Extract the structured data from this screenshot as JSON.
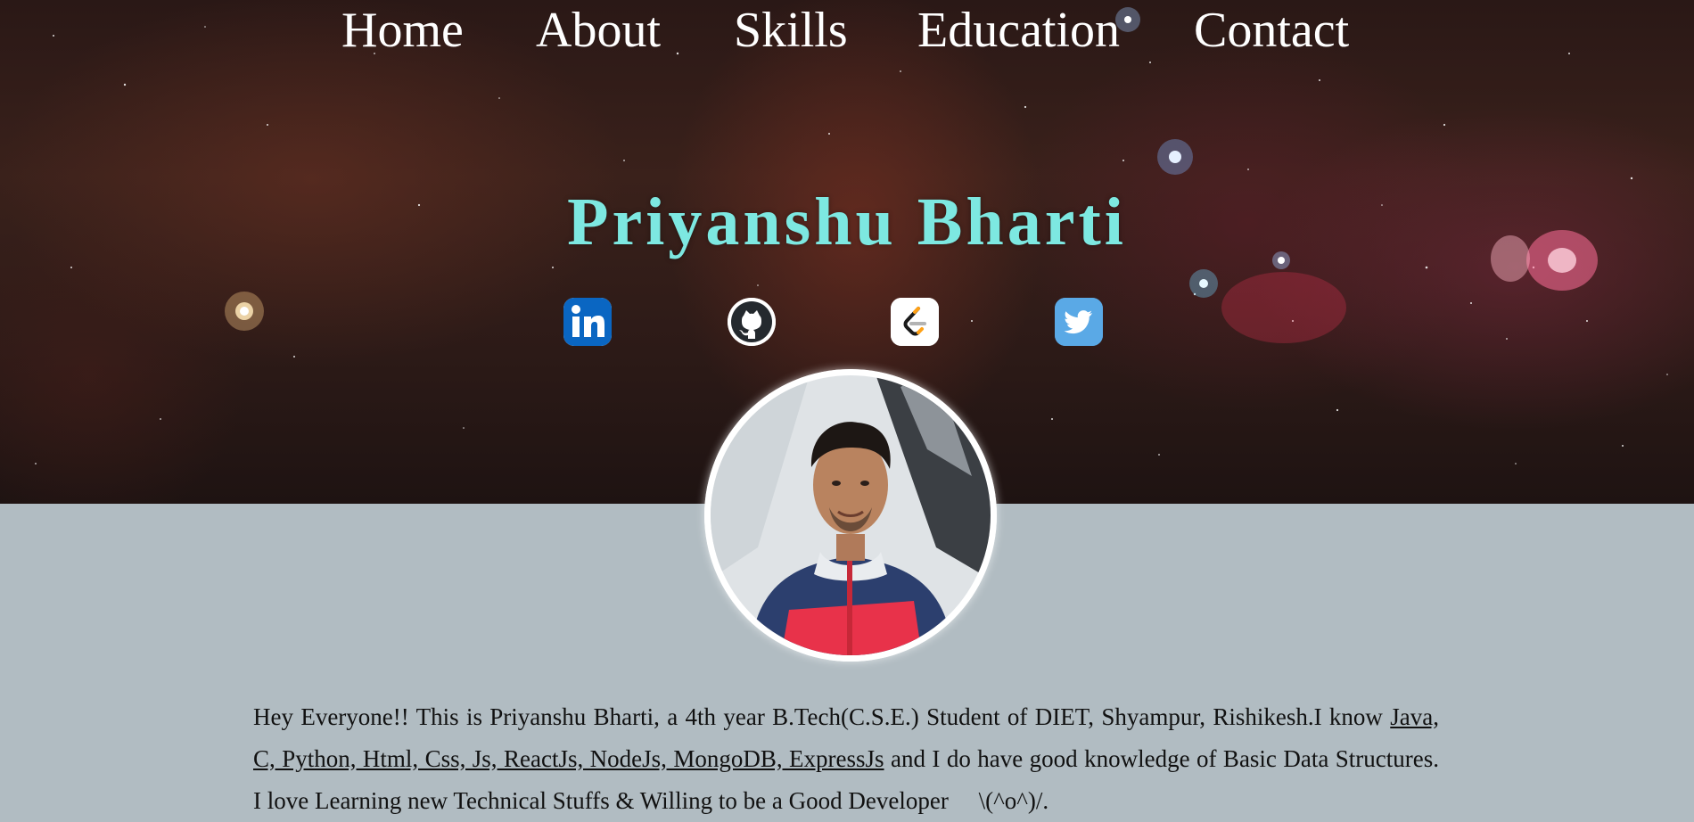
{
  "nav": {
    "items": [
      {
        "label": "Home"
      },
      {
        "label": "About"
      },
      {
        "label": "Skills"
      },
      {
        "label": "Education"
      },
      {
        "label": "Contact"
      }
    ]
  },
  "profile": {
    "name": "Priyanshu Bharti"
  },
  "social": [
    {
      "icon": "linkedin-icon",
      "color": "#0a66c2"
    },
    {
      "icon": "github-icon",
      "color": "#24292e"
    },
    {
      "icon": "leetcode-icon",
      "color": "#ffa116"
    },
    {
      "icon": "twitter-icon",
      "color": "#1da1f2"
    }
  ],
  "about": {
    "intro": "Hey Everyone!! This is Priyanshu Bharti, a 4th year B.Tech(C.S.E.) Student of DIET, Shyampur, Rishikesh.I know ",
    "skills": "Java, C, Python, Html, Css, Js, ReactJs, NodeJs, MongoDB, ExpressJs",
    "outro": " and I do have good knowledge of Basic Data Structures. I love Learning new Technical Stuffs & Willing to be a Good Developer",
    "emoticon": "\\(^o^)/."
  },
  "colors": {
    "name": "#7de8e1",
    "page_background": "#b1bcc2",
    "nav_text": "#ffffff"
  }
}
